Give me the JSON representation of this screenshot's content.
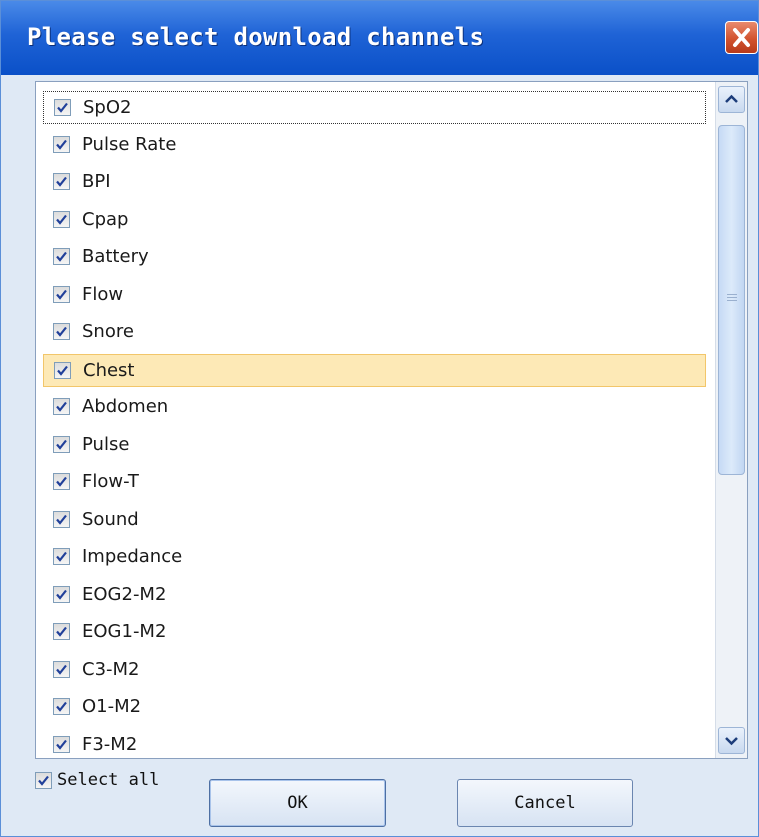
{
  "window": {
    "title": "Please select download channels",
    "close_icon": "close-icon"
  },
  "channels": [
    {
      "label": "SpO2",
      "checked": true,
      "state": "focused"
    },
    {
      "label": "Pulse Rate",
      "checked": true
    },
    {
      "label": "BPI",
      "checked": true
    },
    {
      "label": "Cpap",
      "checked": true
    },
    {
      "label": "Battery",
      "checked": true
    },
    {
      "label": "Flow",
      "checked": true
    },
    {
      "label": "Snore",
      "checked": true
    },
    {
      "label": "Chest",
      "checked": true,
      "state": "selected"
    },
    {
      "label": "Abdomen",
      "checked": true
    },
    {
      "label": "Pulse",
      "checked": true
    },
    {
      "label": "Flow-T",
      "checked": true
    },
    {
      "label": "Sound",
      "checked": true
    },
    {
      "label": "Impedance",
      "checked": true
    },
    {
      "label": "EOG2-M2",
      "checked": true
    },
    {
      "label": "EOG1-M2",
      "checked": true
    },
    {
      "label": "C3-M2",
      "checked": true
    },
    {
      "label": "O1-M2",
      "checked": true
    },
    {
      "label": "F3-M2",
      "checked": true
    }
  ],
  "footer": {
    "select_all_label": "Select all",
    "select_all_checked": true,
    "ok_label": "OK",
    "cancel_label": "Cancel"
  },
  "colors": {
    "titlebar": "#0a50c8",
    "selection": "#fde9b6",
    "close_button": "#d2532f"
  }
}
